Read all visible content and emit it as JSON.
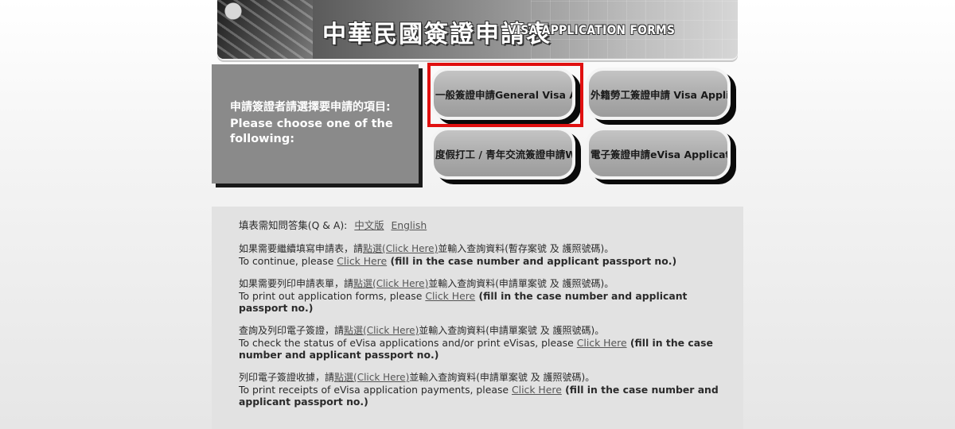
{
  "banner": {
    "title_zh": "中華民國簽證申請表",
    "title_en": "VISA APPLICATION FORMS"
  },
  "choose": {
    "zh": "申請簽證者請選擇要申請的項目:",
    "en": "Please choose one of the following:"
  },
  "buttons": [
    {
      "label": "一般簽證申請General Visa Ap"
    },
    {
      "label": "外籍勞工簽證申請 Visa Applica"
    },
    {
      "label": "度假打工 / 青年交流簽證申請Wor"
    },
    {
      "label": "電子簽證申請eVisa Applicatio"
    }
  ],
  "highlight_color": "#e01010",
  "faq": {
    "label": "填表需知問答集(Q & A):",
    "link_zh": "中文版",
    "link_en": "English"
  },
  "blocks": [
    {
      "zh_pre": "如果需要繼續填寫申請表，請",
      "zh_link": "點選(Click Here)",
      "zh_post": "並輸入查詢資料(暫存案號 及 護照號碼)。",
      "en_pre": "To continue, please ",
      "en_link": "Click Here",
      "en_bold": " (fill in the case number and applicant passport no.)"
    },
    {
      "zh_pre": "如果需要列印申請表單，請",
      "zh_link": "點選(Click Here)",
      "zh_post": "並輸入查詢資料(申請單案號 及 護照號碼)。",
      "en_pre": "To print out application forms, please ",
      "en_link": "Click Here",
      "en_bold": " (fill in the case number and applicant passport no.)"
    },
    {
      "zh_pre": "查詢及列印電子簽證，請",
      "zh_link": "點選(Click Here)",
      "zh_post": "並輸入查詢資料(申請單案號 及 護照號碼)。",
      "en_pre": "To check the status of eVisa applications and/or print eVisas, please ",
      "en_link": "Click Here",
      "en_bold": " (fill in the case number and applicant passport no.)"
    },
    {
      "zh_pre": "列印電子簽證收據，請",
      "zh_link": "點選(Click Here)",
      "zh_post": "並輸入查詢資料(申請單案號 及 護照號碼)。",
      "en_pre": "To print receipts of eVisa application payments, please ",
      "en_link": "Click Here",
      "en_bold": " (fill in the case number and applicant passport no.)"
    }
  ]
}
